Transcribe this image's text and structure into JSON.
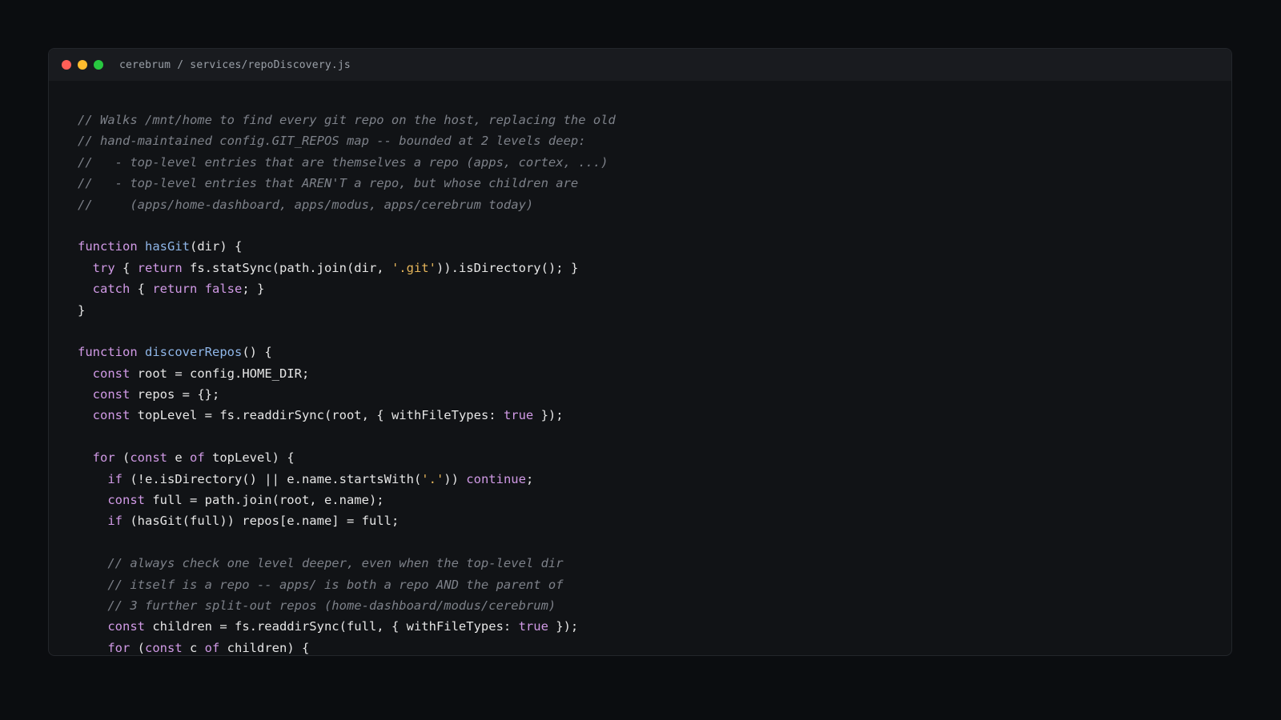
{
  "colors": {
    "background": "#0b0d10",
    "window": "#111316",
    "titlebar": "#191b1f",
    "plain": "#e6e6e6",
    "keyword": "#d19ae6",
    "function": "#8fb6e8",
    "string": "#e5b55a",
    "comment": "#7d8189"
  },
  "window": {
    "controls": [
      {
        "name": "close",
        "color": "#ff5f57"
      },
      {
        "name": "minimize",
        "color": "#febc2e"
      },
      {
        "name": "maximize",
        "color": "#28c840"
      }
    ],
    "title": "cerebrum / services/repoDiscovery.js"
  },
  "code": {
    "lines": [
      [
        [
          "cm",
          "// Walks /mnt/home to find every git repo on the host, replacing the old"
        ]
      ],
      [
        [
          "cm",
          "// hand-maintained config.GIT_REPOS map -- bounded at 2 levels deep:"
        ]
      ],
      [
        [
          "cm",
          "//   - top-level entries that are themselves a repo (apps, cortex, ...)"
        ]
      ],
      [
        [
          "cm",
          "//   - top-level entries that AREN'T a repo, but whose children are"
        ]
      ],
      [
        [
          "cm",
          "//     (apps/home-dashboard, apps/modus, apps/cerebrum today)"
        ]
      ],
      [],
      [
        [
          "kw",
          "function"
        ],
        [
          "plain",
          " "
        ],
        [
          "fn",
          "hasGit"
        ],
        [
          "plain",
          "(dir) {"
        ]
      ],
      [
        [
          "plain",
          "  "
        ],
        [
          "kw",
          "try"
        ],
        [
          "plain",
          " { "
        ],
        [
          "kw",
          "return"
        ],
        [
          "plain",
          " fs.statSync(path.join(dir, "
        ],
        [
          "str",
          "'.git'"
        ],
        [
          "plain",
          ")).isDirectory(); }"
        ]
      ],
      [
        [
          "plain",
          "  "
        ],
        [
          "kw",
          "catch"
        ],
        [
          "plain",
          " { "
        ],
        [
          "kw",
          "return"
        ],
        [
          "plain",
          " "
        ],
        [
          "kw",
          "false"
        ],
        [
          "plain",
          "; }"
        ]
      ],
      [
        [
          "plain",
          "}"
        ]
      ],
      [],
      [
        [
          "kw",
          "function"
        ],
        [
          "plain",
          " "
        ],
        [
          "fn",
          "discoverRepos"
        ],
        [
          "plain",
          "() {"
        ]
      ],
      [
        [
          "plain",
          "  "
        ],
        [
          "kw",
          "const"
        ],
        [
          "plain",
          " root = config.HOME_DIR;"
        ]
      ],
      [
        [
          "plain",
          "  "
        ],
        [
          "kw",
          "const"
        ],
        [
          "plain",
          " repos = {};"
        ]
      ],
      [
        [
          "plain",
          "  "
        ],
        [
          "kw",
          "const"
        ],
        [
          "plain",
          " topLevel = fs.readdirSync(root, { withFileTypes: "
        ],
        [
          "kw",
          "true"
        ],
        [
          "plain",
          " });"
        ]
      ],
      [],
      [
        [
          "plain",
          "  "
        ],
        [
          "kw",
          "for"
        ],
        [
          "plain",
          " ("
        ],
        [
          "kw",
          "const"
        ],
        [
          "plain",
          " e "
        ],
        [
          "kw",
          "of"
        ],
        [
          "plain",
          " topLevel) {"
        ]
      ],
      [
        [
          "plain",
          "    "
        ],
        [
          "kw",
          "if"
        ],
        [
          "plain",
          " (!e.isDirectory() || e.name.startsWith("
        ],
        [
          "str",
          "'.'"
        ],
        [
          "plain",
          ")) "
        ],
        [
          "kw",
          "continue"
        ],
        [
          "plain",
          ";"
        ]
      ],
      [
        [
          "plain",
          "    "
        ],
        [
          "kw",
          "const"
        ],
        [
          "plain",
          " full = path.join(root, e.name);"
        ]
      ],
      [
        [
          "plain",
          "    "
        ],
        [
          "kw",
          "if"
        ],
        [
          "plain",
          " (hasGit(full)) repos[e.name] = full;"
        ]
      ],
      [],
      [
        [
          "plain",
          "    "
        ],
        [
          "cm",
          "// always check one level deeper, even when the top-level dir"
        ]
      ],
      [
        [
          "plain",
          "    "
        ],
        [
          "cm",
          "// itself is a repo -- apps/ is both a repo AND the parent of"
        ]
      ],
      [
        [
          "plain",
          "    "
        ],
        [
          "cm",
          "// 3 further split-out repos (home-dashboard/modus/cerebrum)"
        ]
      ],
      [
        [
          "plain",
          "    "
        ],
        [
          "kw",
          "const"
        ],
        [
          "plain",
          " children = fs.readdirSync(full, { withFileTypes: "
        ],
        [
          "kw",
          "true"
        ],
        [
          "plain",
          " });"
        ]
      ],
      [
        [
          "plain",
          "    "
        ],
        [
          "kw",
          "for"
        ],
        [
          "plain",
          " ("
        ],
        [
          "kw",
          "const"
        ],
        [
          "plain",
          " c "
        ],
        [
          "kw",
          "of"
        ],
        [
          "plain",
          " children) {"
        ]
      ]
    ]
  }
}
